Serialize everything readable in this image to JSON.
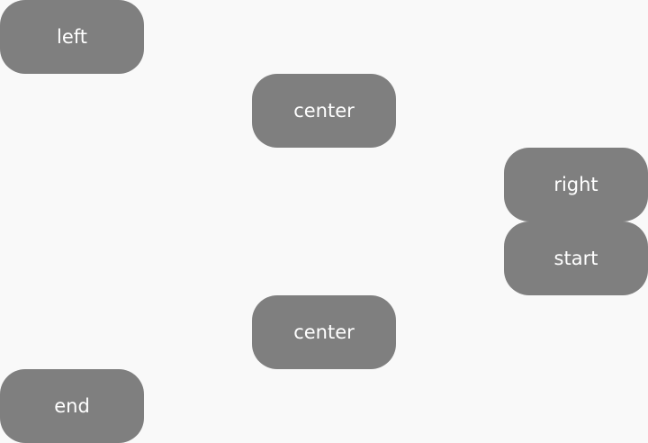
{
  "colors": {
    "background": "#f9f9f9",
    "pill_fill": "#7f7f7f",
    "pill_text": "#ffffff"
  },
  "pills": [
    {
      "label": "left"
    },
    {
      "label": "center"
    },
    {
      "label": "right"
    },
    {
      "label": "start"
    },
    {
      "label": "center"
    },
    {
      "label": "end"
    }
  ]
}
